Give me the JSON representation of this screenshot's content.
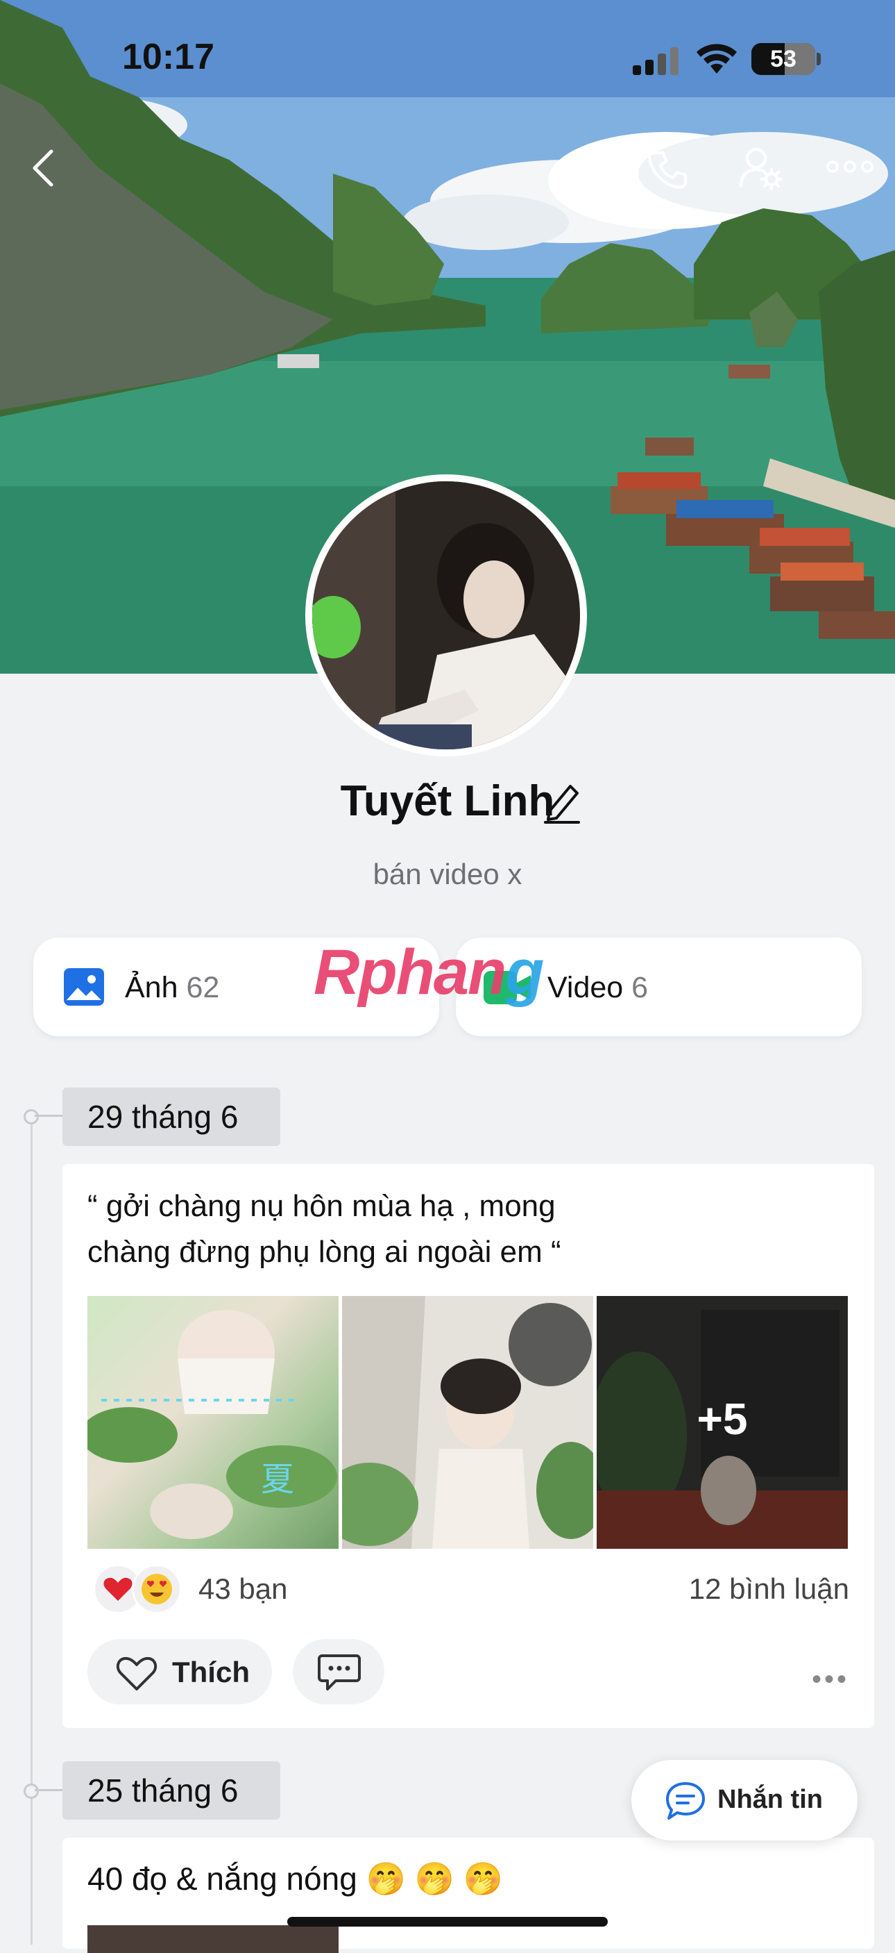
{
  "status_bar": {
    "time": "10:17",
    "battery": "53"
  },
  "profile": {
    "name": "Tuyết Linh",
    "bio": "bán video x"
  },
  "media": {
    "photos": {
      "label": "Ảnh",
      "count": "62"
    },
    "videos": {
      "label": "Video",
      "count": "6"
    }
  },
  "watermark": {
    "part1": "Rphan",
    "part2": "g"
  },
  "posts": [
    {
      "date": "29 tháng 6",
      "text_line1": "“ gởi chàng nụ hôn mùa hạ , mong",
      "text_line2": "chàng đừng phụ lòng ai ngoài em “",
      "more_photos": "+5",
      "reactions": [
        "❤️",
        "😍"
      ],
      "reaction_count": "43 bạn",
      "comment_count": "12 bình luận",
      "like_label": "Thích",
      "more": "•••"
    },
    {
      "date": "25 tháng 6",
      "text": "40 đọ & nắng nóng 🤭 🤭 🤭"
    }
  ],
  "message_button": {
    "label": "Nhắn tin"
  },
  "icons": [
    "back-icon",
    "phone-icon",
    "user-settings-icon",
    "more-icon",
    "edit-icon",
    "photo-icon",
    "video-icon",
    "heart-icon",
    "comment-icon",
    "message-icon"
  ]
}
